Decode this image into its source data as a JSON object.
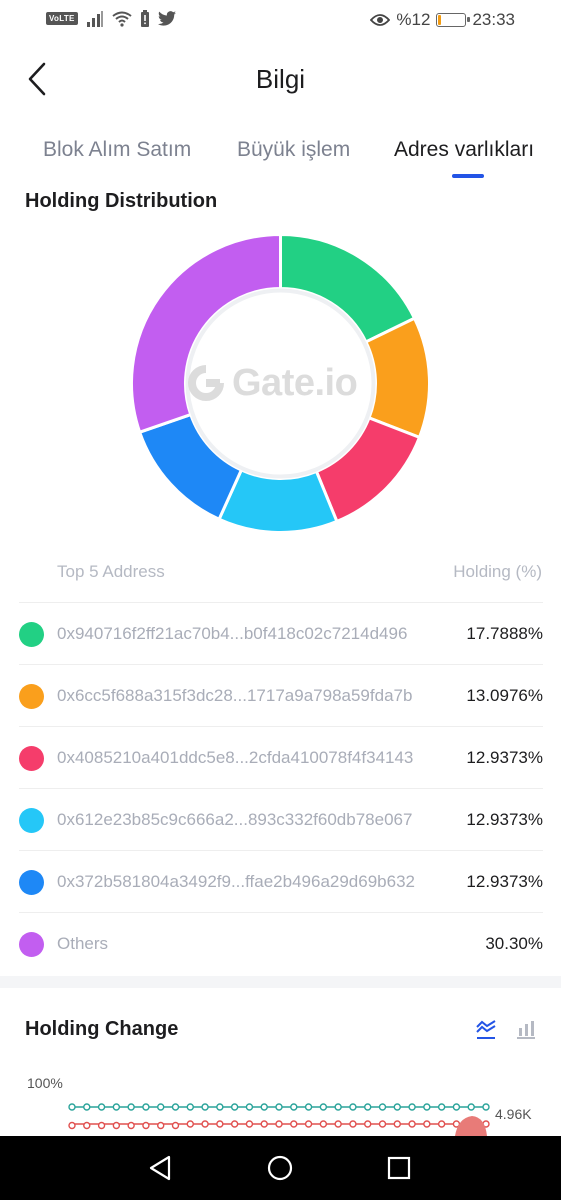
{
  "status_bar": {
    "volte": "VoLTE",
    "battery_text": "%12",
    "battery_level": 0.12,
    "time": "23:33",
    "icons": [
      "signal-icon",
      "wifi-icon",
      "battery-alert-icon",
      "twitter-icon",
      "eye-icon"
    ]
  },
  "header": {
    "title": "Bilgi",
    "back_icon": "back-arrow-icon"
  },
  "tabs": [
    {
      "label": "Blok Alım Satım",
      "active": false
    },
    {
      "label": "Büyük işlem",
      "active": false
    },
    {
      "label": "Adres varlıkları",
      "active": true
    }
  ],
  "distribution": {
    "title": "Holding Distribution",
    "watermark": "Gate.io",
    "col_address": "Top 5 Address",
    "col_holding": "Holding (%)",
    "rows": [
      {
        "address": "0x940716f2ff21ac70b4...b0f418c02c7214d496",
        "pct": "17.7888%",
        "color": "#22d084"
      },
      {
        "address": "0x6cc5f688a315f3dc28...1717a9a798a59fda7b",
        "pct": "13.0976%",
        "color": "#fa9f1c"
      },
      {
        "address": "0x4085210a401ddc5e8...2cfda410078f4f34143",
        "pct": "12.9373%",
        "color": "#f53d6b"
      },
      {
        "address": "0x612e23b85c9c666a2...893c332f60db78e067",
        "pct": "12.9373%",
        "color": "#25c7f7"
      },
      {
        "address": "0x372b581804a3492f9...ffae2b496a29d69b632",
        "pct": "12.9373%",
        "color": "#1e88f6"
      },
      {
        "address": "Others",
        "pct": "30.30%",
        "color": "#c25ef0"
      }
    ]
  },
  "chart_data": {
    "type": "pie",
    "categories": [
      "0x940716f2ff21ac70b4...b0f418c02c7214d496",
      "0x6cc5f688a315f3dc28...1717a9a798a59fda7b",
      "0x4085210a401ddc5e8...2cfda410078f4f34143",
      "0x612e23b85c9c666a2...893c332f60db78e067",
      "0x372b581804a3492f9...ffae2b496a29d69b632",
      "Others"
    ],
    "values": [
      17.7888,
      13.0976,
      12.9373,
      12.9373,
      12.9373,
      30.3
    ],
    "colors": [
      "#22d084",
      "#fa9f1c",
      "#f53d6b",
      "#25c7f7",
      "#1e88f6",
      "#c25ef0"
    ],
    "title": "Holding Distribution"
  },
  "change": {
    "title": "Holding Change",
    "y_label": "100%",
    "end_label": "4.96K",
    "line_icon": "line-chart-icon",
    "bar_icon": "bar-chart-icon",
    "series": [
      {
        "color": "#2aa39a",
        "level": 1.0
      },
      {
        "color": "#e0504f",
        "level": 0.95
      }
    ]
  },
  "nav": {
    "back": "nav-back-icon",
    "home": "nav-home-icon",
    "recents": "nav-recents-icon"
  }
}
